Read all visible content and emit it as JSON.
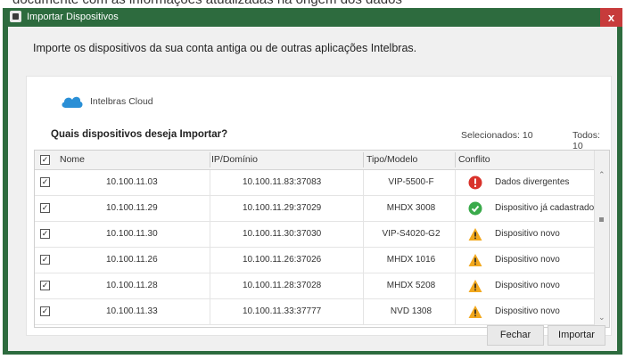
{
  "top_caption": "documente com as informações atualizadas na origem dos dados",
  "window": {
    "title": "Importar Dispositivos",
    "close_glyph": "x",
    "colors": {
      "frame": "#2d6b3e",
      "close": "#c73b3b",
      "cloud": "#2a8fd6",
      "ok": "#3aaa4b",
      "error": "#d9322b",
      "warning": "#f2a81d"
    }
  },
  "intro": "Importe os dispositivos da sua conta antiga ou de outras aplicações Intelbras.",
  "source": {
    "icon": "cloud-icon",
    "label": "Intelbras Cloud"
  },
  "question": "Quais dispositivos deseja Importar?",
  "counts": {
    "selected": "Selecionados: 10",
    "total": "Todos: 10"
  },
  "table": {
    "columns": [
      "Nome",
      "IP/Domínio",
      "Tipo/Modelo",
      "Conflito"
    ],
    "header_checked": true,
    "rows": [
      {
        "checked": true,
        "name": "10.100.11.03",
        "ip": "10.100.11.83:37083",
        "model": "VIP-5500-F",
        "status": "error",
        "message": "Dados divergentes"
      },
      {
        "checked": true,
        "name": "10.100.11.29",
        "ip": "10.100.11.29:37029",
        "model": "MHDX 3008",
        "status": "ok",
        "message": "Dispositivo já cadastrado"
      },
      {
        "checked": true,
        "name": "10.100.11.30",
        "ip": "10.100.11.30:37030",
        "model": "VIP-S4020-G2",
        "status": "warning",
        "message": "Dispositivo novo"
      },
      {
        "checked": true,
        "name": "10.100.11.26",
        "ip": "10.100.11.26:37026",
        "model": "MHDX 1016",
        "status": "warning",
        "message": "Dispositivo novo"
      },
      {
        "checked": true,
        "name": "10.100.11.28",
        "ip": "10.100.11.28:37028",
        "model": "MHDX 5208",
        "status": "warning",
        "message": "Dispositivo novo"
      },
      {
        "checked": true,
        "name": "10.100.11.33",
        "ip": "10.100.11.33:37777",
        "model": "NVD 1308",
        "status": "warning",
        "message": "Dispositivo novo"
      }
    ]
  },
  "buttons": {
    "close": "Fechar",
    "import": "Importar"
  }
}
